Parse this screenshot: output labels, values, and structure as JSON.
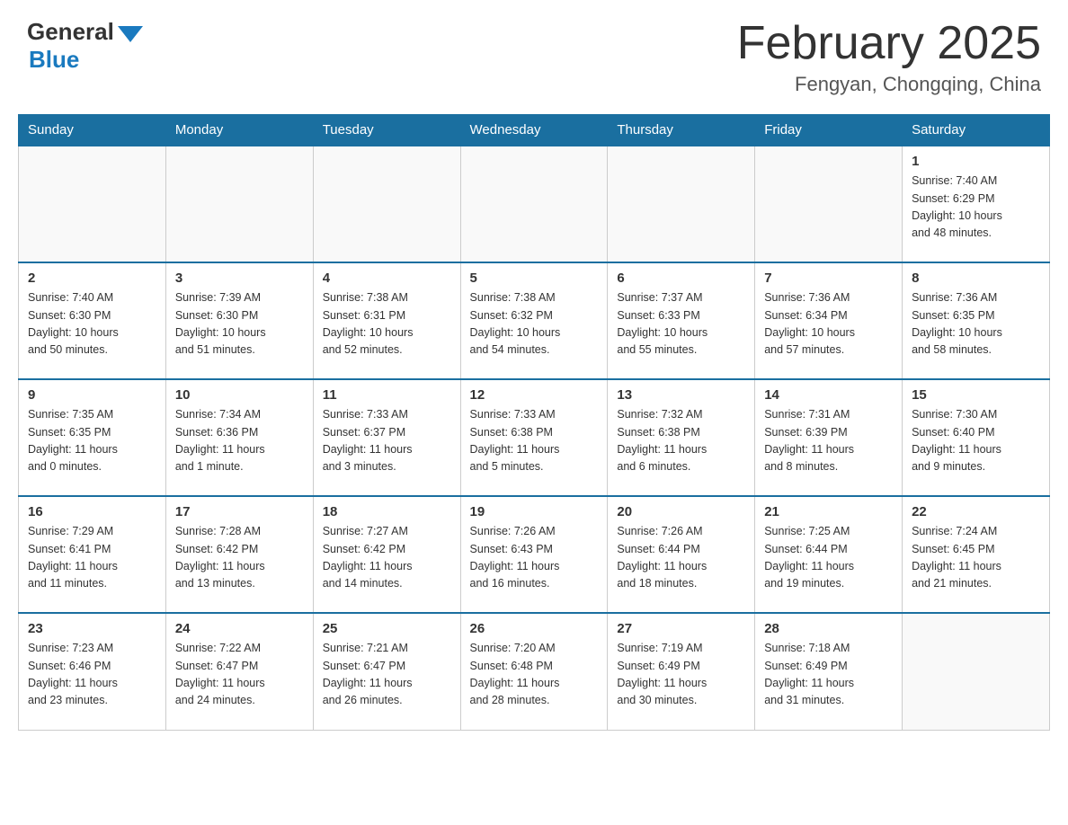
{
  "header": {
    "logo_general": "General",
    "logo_blue": "Blue",
    "month_title": "February 2025",
    "location": "Fengyan, Chongqing, China"
  },
  "calendar": {
    "days_of_week": [
      "Sunday",
      "Monday",
      "Tuesday",
      "Wednesday",
      "Thursday",
      "Friday",
      "Saturday"
    ],
    "weeks": [
      [
        {
          "day": "",
          "info": ""
        },
        {
          "day": "",
          "info": ""
        },
        {
          "day": "",
          "info": ""
        },
        {
          "day": "",
          "info": ""
        },
        {
          "day": "",
          "info": ""
        },
        {
          "day": "",
          "info": ""
        },
        {
          "day": "1",
          "info": "Sunrise: 7:40 AM\nSunset: 6:29 PM\nDaylight: 10 hours\nand 48 minutes."
        }
      ],
      [
        {
          "day": "2",
          "info": "Sunrise: 7:40 AM\nSunset: 6:30 PM\nDaylight: 10 hours\nand 50 minutes."
        },
        {
          "day": "3",
          "info": "Sunrise: 7:39 AM\nSunset: 6:30 PM\nDaylight: 10 hours\nand 51 minutes."
        },
        {
          "day": "4",
          "info": "Sunrise: 7:38 AM\nSunset: 6:31 PM\nDaylight: 10 hours\nand 52 minutes."
        },
        {
          "day": "5",
          "info": "Sunrise: 7:38 AM\nSunset: 6:32 PM\nDaylight: 10 hours\nand 54 minutes."
        },
        {
          "day": "6",
          "info": "Sunrise: 7:37 AM\nSunset: 6:33 PM\nDaylight: 10 hours\nand 55 minutes."
        },
        {
          "day": "7",
          "info": "Sunrise: 7:36 AM\nSunset: 6:34 PM\nDaylight: 10 hours\nand 57 minutes."
        },
        {
          "day": "8",
          "info": "Sunrise: 7:36 AM\nSunset: 6:35 PM\nDaylight: 10 hours\nand 58 minutes."
        }
      ],
      [
        {
          "day": "9",
          "info": "Sunrise: 7:35 AM\nSunset: 6:35 PM\nDaylight: 11 hours\nand 0 minutes."
        },
        {
          "day": "10",
          "info": "Sunrise: 7:34 AM\nSunset: 6:36 PM\nDaylight: 11 hours\nand 1 minute."
        },
        {
          "day": "11",
          "info": "Sunrise: 7:33 AM\nSunset: 6:37 PM\nDaylight: 11 hours\nand 3 minutes."
        },
        {
          "day": "12",
          "info": "Sunrise: 7:33 AM\nSunset: 6:38 PM\nDaylight: 11 hours\nand 5 minutes."
        },
        {
          "day": "13",
          "info": "Sunrise: 7:32 AM\nSunset: 6:38 PM\nDaylight: 11 hours\nand 6 minutes."
        },
        {
          "day": "14",
          "info": "Sunrise: 7:31 AM\nSunset: 6:39 PM\nDaylight: 11 hours\nand 8 minutes."
        },
        {
          "day": "15",
          "info": "Sunrise: 7:30 AM\nSunset: 6:40 PM\nDaylight: 11 hours\nand 9 minutes."
        }
      ],
      [
        {
          "day": "16",
          "info": "Sunrise: 7:29 AM\nSunset: 6:41 PM\nDaylight: 11 hours\nand 11 minutes."
        },
        {
          "day": "17",
          "info": "Sunrise: 7:28 AM\nSunset: 6:42 PM\nDaylight: 11 hours\nand 13 minutes."
        },
        {
          "day": "18",
          "info": "Sunrise: 7:27 AM\nSunset: 6:42 PM\nDaylight: 11 hours\nand 14 minutes."
        },
        {
          "day": "19",
          "info": "Sunrise: 7:26 AM\nSunset: 6:43 PM\nDaylight: 11 hours\nand 16 minutes."
        },
        {
          "day": "20",
          "info": "Sunrise: 7:26 AM\nSunset: 6:44 PM\nDaylight: 11 hours\nand 18 minutes."
        },
        {
          "day": "21",
          "info": "Sunrise: 7:25 AM\nSunset: 6:44 PM\nDaylight: 11 hours\nand 19 minutes."
        },
        {
          "day": "22",
          "info": "Sunrise: 7:24 AM\nSunset: 6:45 PM\nDaylight: 11 hours\nand 21 minutes."
        }
      ],
      [
        {
          "day": "23",
          "info": "Sunrise: 7:23 AM\nSunset: 6:46 PM\nDaylight: 11 hours\nand 23 minutes."
        },
        {
          "day": "24",
          "info": "Sunrise: 7:22 AM\nSunset: 6:47 PM\nDaylight: 11 hours\nand 24 minutes."
        },
        {
          "day": "25",
          "info": "Sunrise: 7:21 AM\nSunset: 6:47 PM\nDaylight: 11 hours\nand 26 minutes."
        },
        {
          "day": "26",
          "info": "Sunrise: 7:20 AM\nSunset: 6:48 PM\nDaylight: 11 hours\nand 28 minutes."
        },
        {
          "day": "27",
          "info": "Sunrise: 7:19 AM\nSunset: 6:49 PM\nDaylight: 11 hours\nand 30 minutes."
        },
        {
          "day": "28",
          "info": "Sunrise: 7:18 AM\nSunset: 6:49 PM\nDaylight: 11 hours\nand 31 minutes."
        },
        {
          "day": "",
          "info": ""
        }
      ]
    ]
  }
}
